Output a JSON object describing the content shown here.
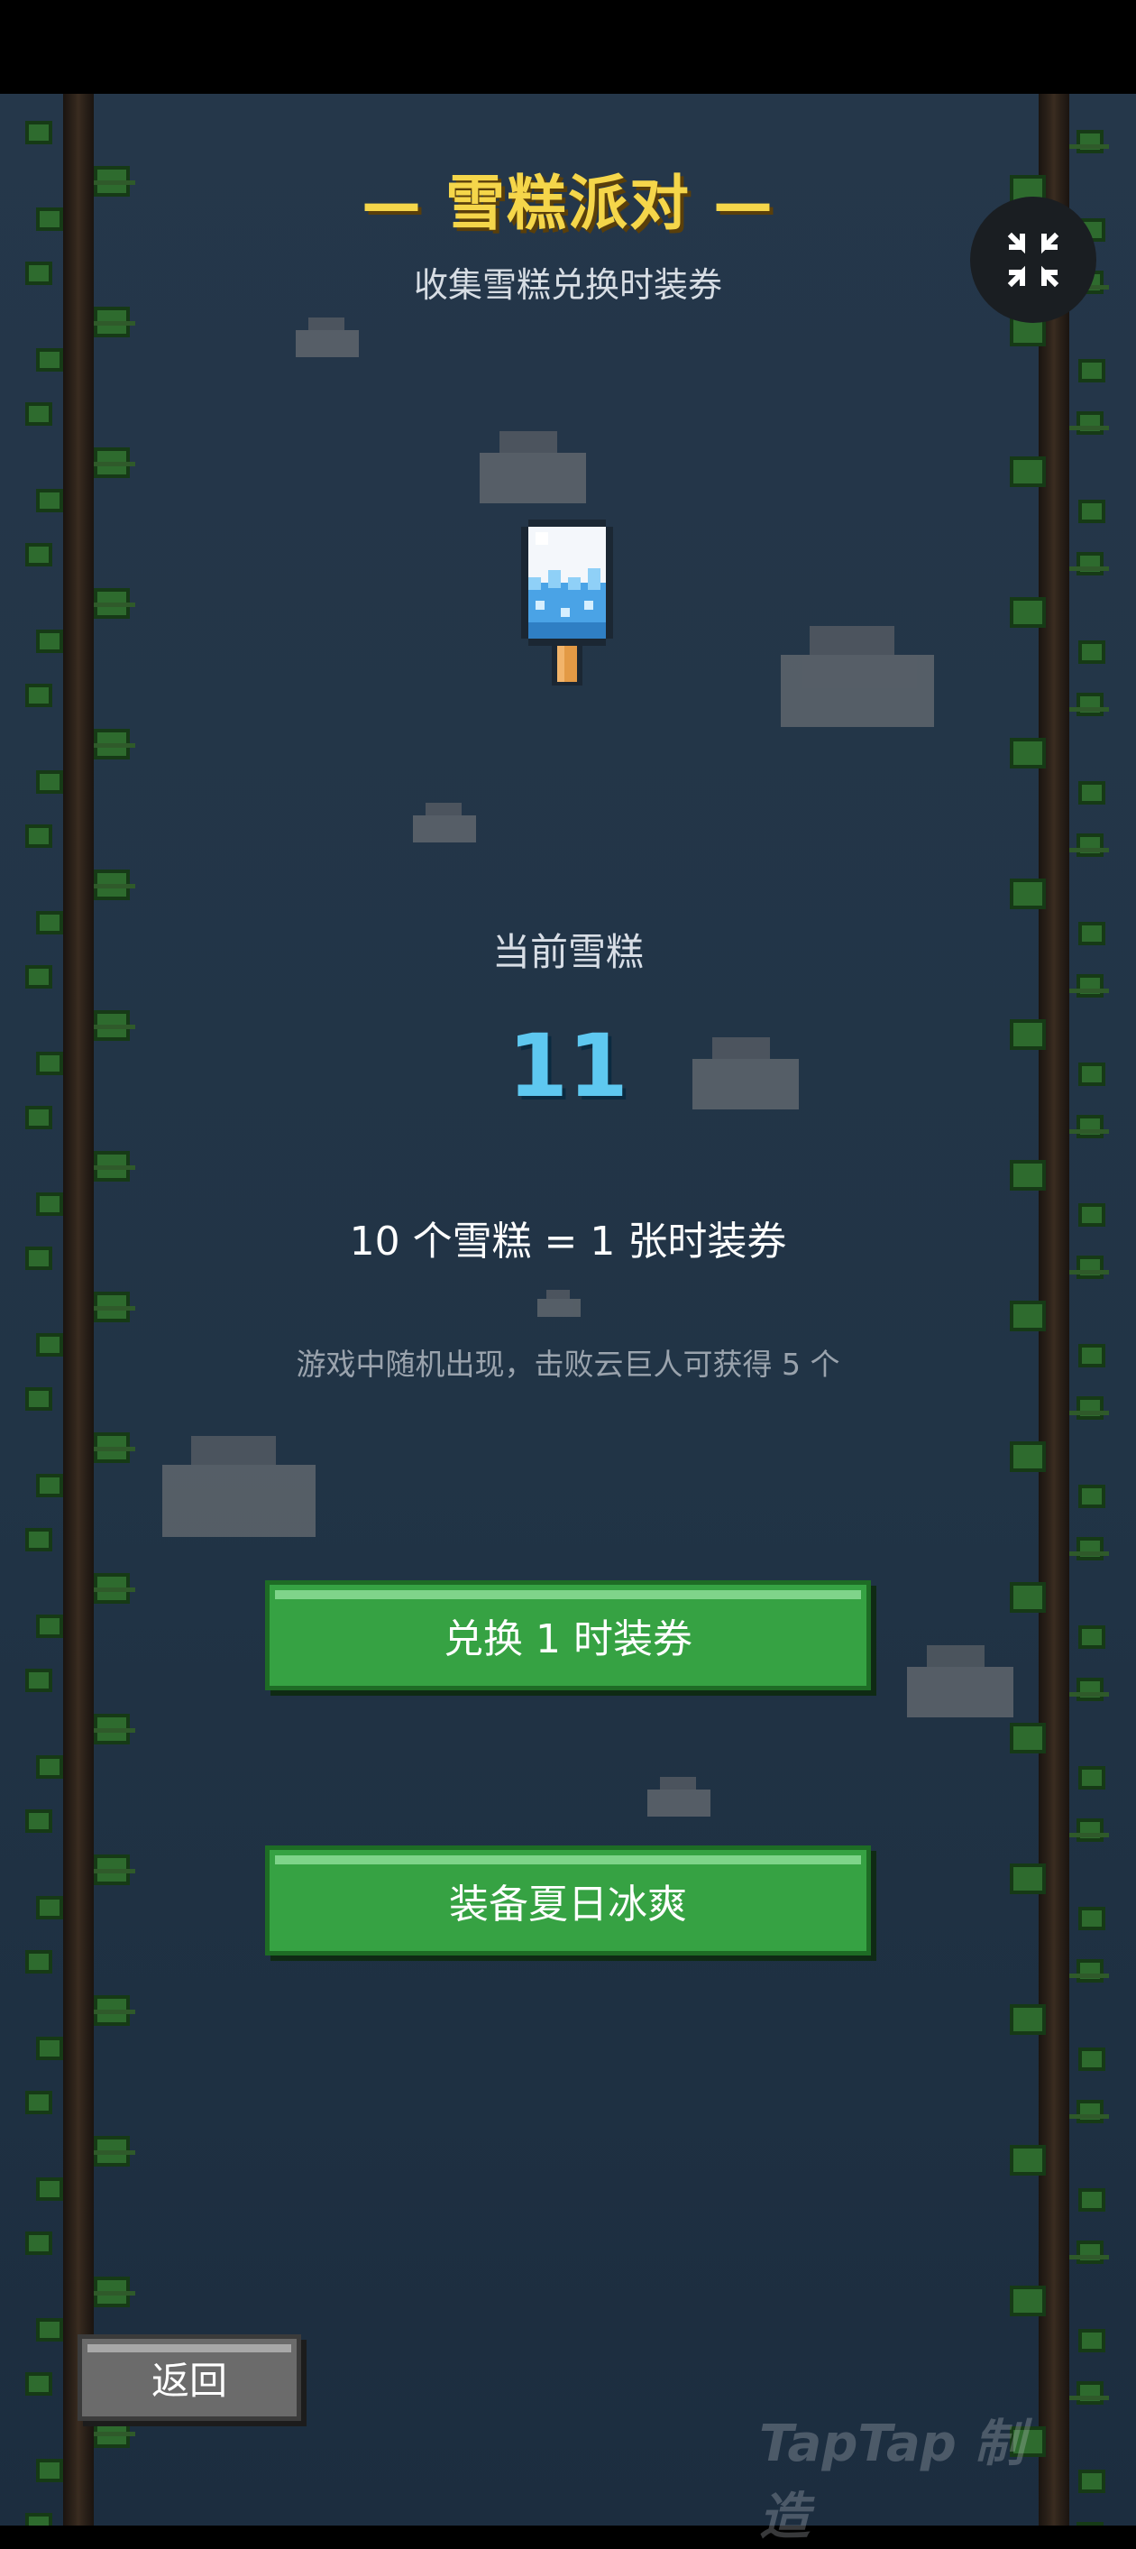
{
  "header": {
    "title": "— 雪糕派对 —",
    "subtitle": "收集雪糕兑换时装券"
  },
  "icons": {
    "item": "popsicle-icon",
    "fullscreen_toggle": "collapse-fullscreen-icon"
  },
  "counter": {
    "label": "当前雪糕",
    "value": "11"
  },
  "exchange_rate": "10 个雪糕 = 1 张时装券",
  "hint": "游戏中随机出现，击败云巨人可获得 5 个",
  "buttons": {
    "exchange": "兑换 1 时装券",
    "equip": "装备夏日冰爽",
    "back": "返回"
  },
  "watermark": "TapTap 制造",
  "colors": {
    "title": "#f5d64a",
    "count": "#5ec8f0",
    "button_green": "#36a243",
    "button_back": "#6b6b6b",
    "background": "#213446"
  }
}
